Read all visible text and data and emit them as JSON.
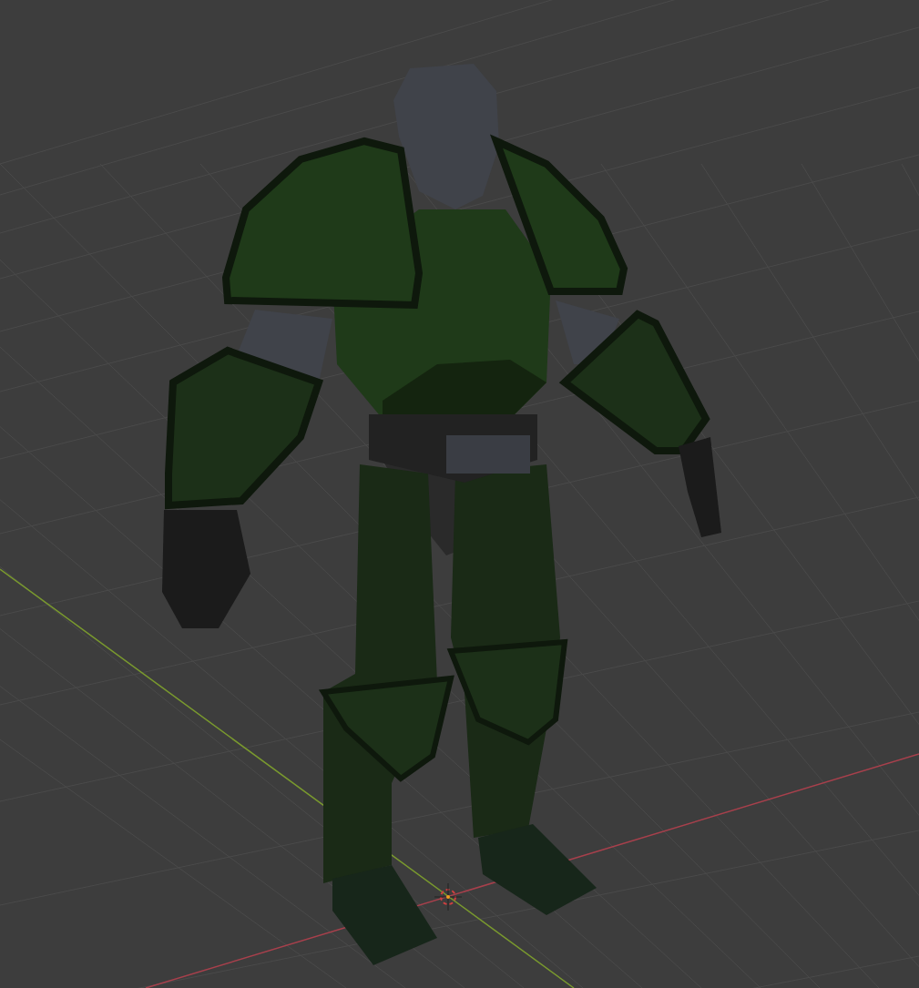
{
  "viewport": {
    "axes": [
      {
        "kind": "x",
        "color": "#a8404c"
      },
      {
        "kind": "y",
        "color": "#7a9a2e"
      }
    ]
  }
}
